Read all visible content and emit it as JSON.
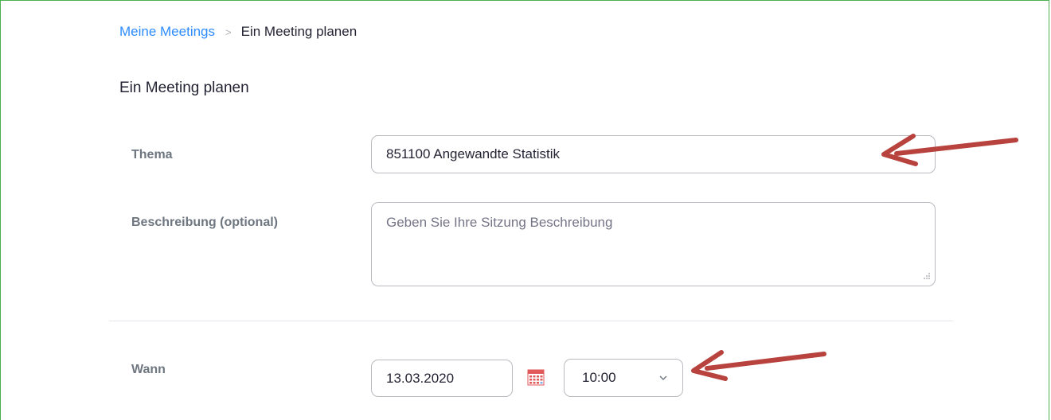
{
  "breadcrumb": {
    "parent": "Meine Meetings",
    "separator": ">",
    "current": "Ein Meeting planen"
  },
  "page_title": "Ein Meeting planen",
  "form": {
    "topic": {
      "label": "Thema",
      "value": "851100 Angewandte Statistik"
    },
    "description": {
      "label": "Beschreibung (optional)",
      "value": "",
      "placeholder": "Geben Sie Ihre Sitzung Beschreibung"
    },
    "when": {
      "label": "Wann",
      "date": "13.03.2020",
      "time": "10:00"
    }
  },
  "icons": {
    "calendar": "calendar-icon",
    "time_dropdown": "chevron-down-icon",
    "resize": "resize-grip-icon"
  },
  "colors": {
    "link": "#2d8cff",
    "annotation_arrow": "#b8423d",
    "frame_border": "#4caf50",
    "calendar": "#e05a5a"
  }
}
